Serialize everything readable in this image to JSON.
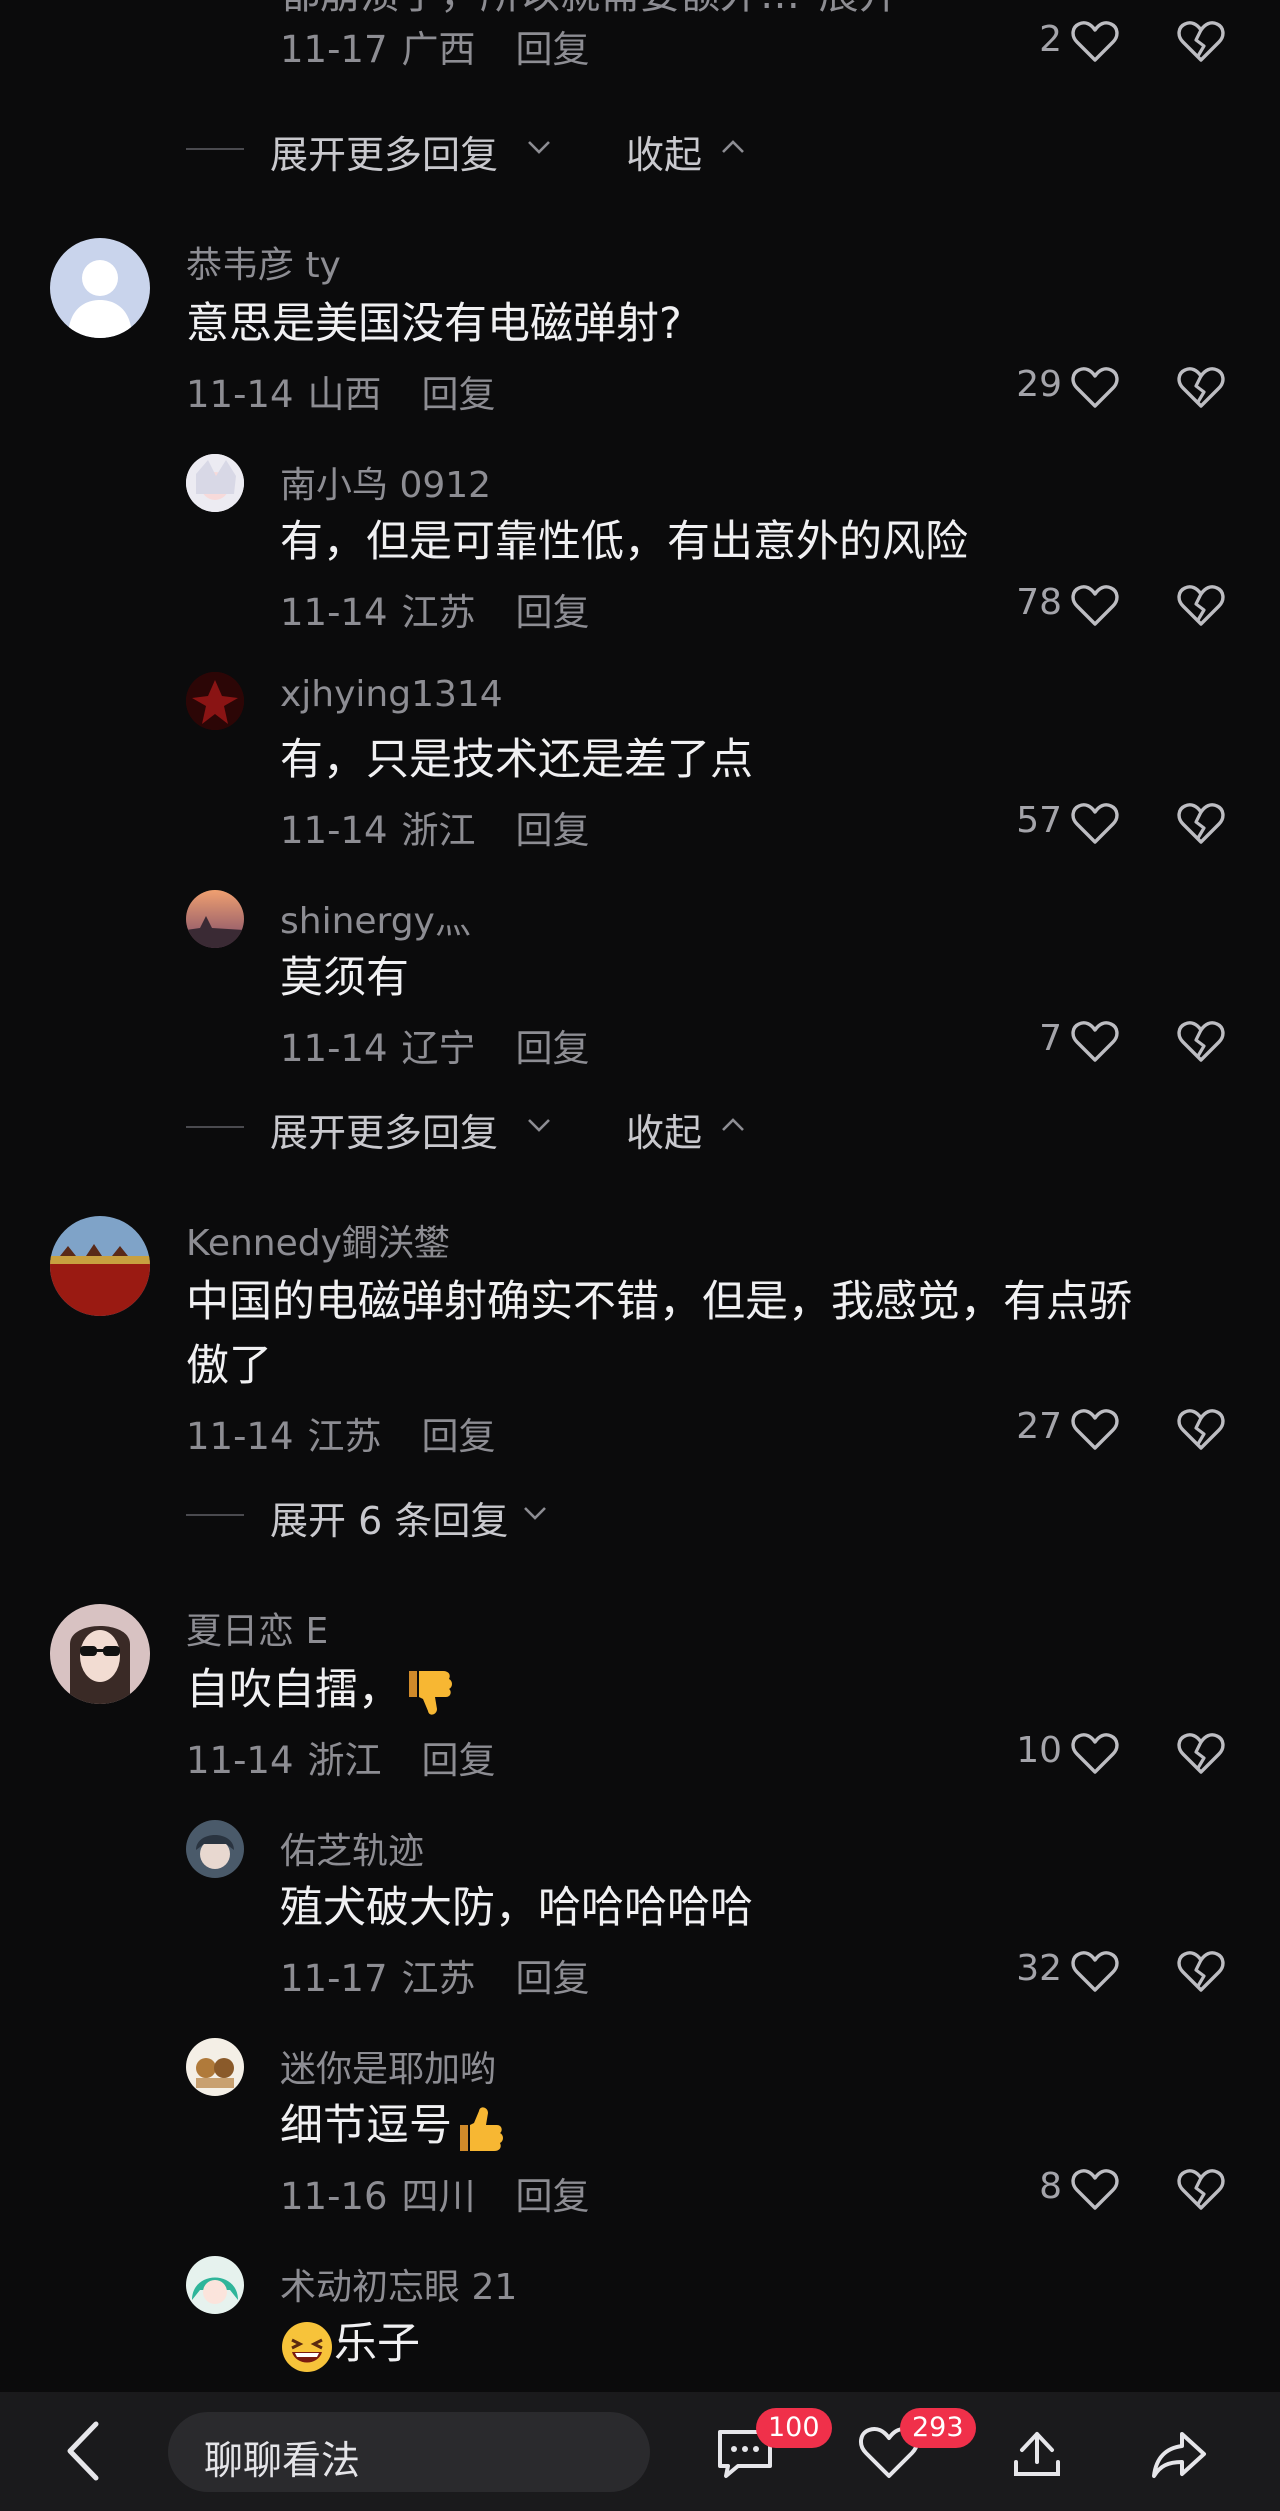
{
  "comments": [
    {
      "id": "c0",
      "truncated_text": "都崩溃了，所以就需要额外…",
      "expand_link": "展开",
      "date": "11-17",
      "location": "广西",
      "reply": "回复",
      "likes": "2"
    },
    {
      "id": "c1",
      "user": "恭韦彦 ty",
      "text": "意思是美国没有电磁弹射?",
      "date": "11-14",
      "location": "山西",
      "reply": "回复",
      "likes": "29"
    },
    {
      "id": "c1r1",
      "user": "南小鸟 0912",
      "text": "有，但是可靠性低，有出意外的风险",
      "date": "11-14",
      "location": "江苏",
      "reply": "回复",
      "likes": "78"
    },
    {
      "id": "c1r2",
      "user": "xjhying1314",
      "text": "有，只是技术还是差了点",
      "date": "11-14",
      "location": "浙江",
      "reply": "回复",
      "likes": "57"
    },
    {
      "id": "c1r3",
      "user": "shinergy灬",
      "text": "莫须有",
      "date": "11-14",
      "location": "辽宁",
      "reply": "回复",
      "likes": "7"
    },
    {
      "id": "c2",
      "user": "Kennedy鐧浂鐢",
      "text_line1": "中国的电磁弹射确实不错，但是，我感觉，有点骄",
      "text_line2": "傲了",
      "date": "11-14",
      "location": "江苏",
      "reply": "回复",
      "likes": "27"
    },
    {
      "id": "c3",
      "user": "夏日恋 E",
      "text": "自吹自擂，",
      "text_emoji": "thumbs-down",
      "date": "11-14",
      "location": "浙江",
      "reply": "回复",
      "likes": "10"
    },
    {
      "id": "c3r1",
      "user": "佑芝轨迹",
      "text": "殖犬破大防，哈哈哈哈哈",
      "date": "11-17",
      "location": "江苏",
      "reply": "回复",
      "likes": "32"
    },
    {
      "id": "c3r2",
      "user": "迷你是耶加哟",
      "text": "细节逗号",
      "text_emoji": "thumbs-up",
      "date": "11-16",
      "location": "四川",
      "reply": "回复",
      "likes": "8"
    },
    {
      "id": "c3r3",
      "user": "术动初忘眼 21",
      "text": "乐子",
      "text_emoji": "laughing-face"
    }
  ],
  "expanders": {
    "more_replies": "展开更多回复",
    "collapse": "收起",
    "expand_six": "展开 6 条回复"
  },
  "bottom_bar": {
    "input_placeholder": "聊聊看法",
    "comment_count": "100",
    "like_count": "293"
  },
  "colors": {
    "background": "#0b0b0c",
    "badge": "#f0304a",
    "muted_text": "#8d8d93"
  },
  "icons": [
    "heart-icon",
    "broken-heart-icon",
    "chevron-down-icon",
    "chevron-up-icon",
    "back-icon",
    "comment-icon",
    "share-icon",
    "forward-icon"
  ]
}
